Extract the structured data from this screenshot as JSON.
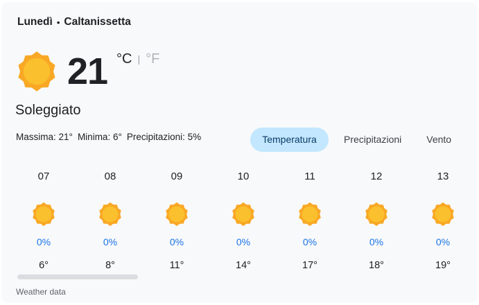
{
  "header": {
    "day": "Lunedì",
    "separator": "•",
    "location": "Caltanissetta"
  },
  "current": {
    "icon": "sun-icon",
    "temperature": "21",
    "unit_c": "°C",
    "unit_separator": "|",
    "unit_f": "°F",
    "condition": "Soleggiato",
    "max_label": "Massima: 21°",
    "min_label": "Minima: 6°",
    "precip_label": "Precipitazioni: 5%"
  },
  "tabs": [
    {
      "label": "Temperatura",
      "active": true
    },
    {
      "label": "Precipitazioni",
      "active": false
    },
    {
      "label": "Vento",
      "active": false
    }
  ],
  "hourly": [
    {
      "hour": "07",
      "precip": "0%",
      "temp": "6°",
      "icon": "sun-icon"
    },
    {
      "hour": "08",
      "precip": "0%",
      "temp": "8°",
      "icon": "sun-icon"
    },
    {
      "hour": "09",
      "precip": "0%",
      "temp": "11°",
      "icon": "sun-icon"
    },
    {
      "hour": "10",
      "precip": "0%",
      "temp": "14°",
      "icon": "sun-icon"
    },
    {
      "hour": "11",
      "precip": "0%",
      "temp": "17°",
      "icon": "sun-icon"
    },
    {
      "hour": "12",
      "precip": "0%",
      "temp": "18°",
      "icon": "sun-icon"
    },
    {
      "hour": "13",
      "precip": "0%",
      "temp": "19°",
      "icon": "sun-icon"
    }
  ],
  "footer": {
    "source": "Weather data"
  },
  "colors": {
    "sun_outer": "#f9a825",
    "sun_inner": "#fbc02d",
    "active_tab_bg": "#c2e7ff",
    "precip_text": "#1a73e8"
  }
}
